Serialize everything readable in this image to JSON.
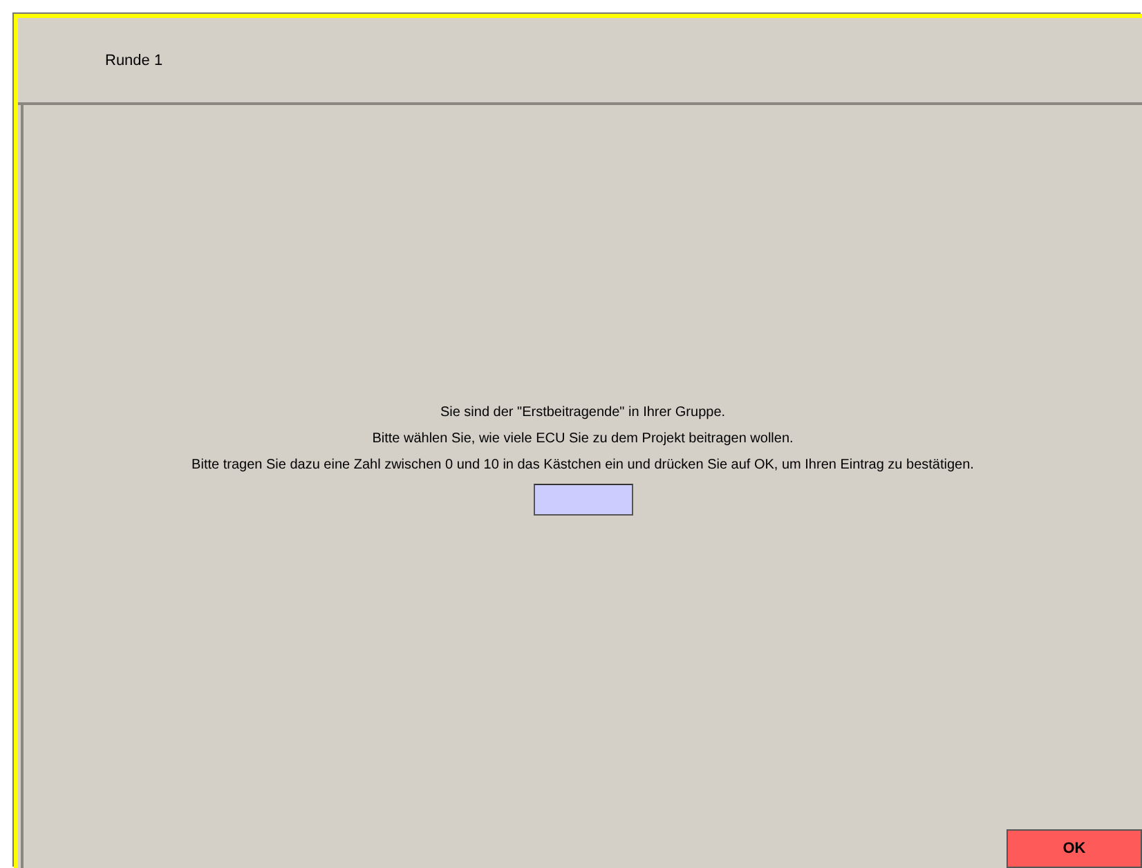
{
  "header": {
    "title": "Runde 1"
  },
  "instructions": [
    "Sie sind der \"Erstbeitragende\" in Ihrer Gruppe.",
    "Bitte wählen Sie, wie viele ECU Sie zu dem Projekt beitragen wollen.",
    "Bitte tragen Sie dazu eine Zahl zwischen 0 und 10 in das Kästchen ein und drücken Sie auf OK, um Ihren Eintrag zu bestätigen."
  ],
  "buttons": [
    "OK"
  ]
}
